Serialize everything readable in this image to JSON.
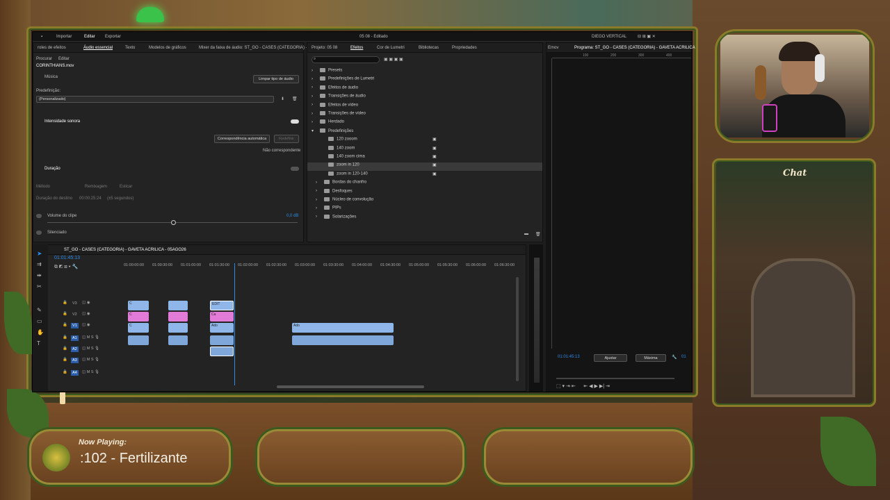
{
  "window": {
    "menu": [
      "Importar",
      "Editar",
      "Exportar"
    ],
    "title": "05 08 - Editado",
    "workspace": "DIEGO VERTICAL"
  },
  "essential": {
    "tabs": [
      "roles de efeitos",
      "Áudio essencial",
      "Texto",
      "Modelos de gráficos",
      "Mixer da faixa de áudio: ST_GO - CASES (CATEGORIA) -"
    ],
    "subtabs": [
      "Procurar",
      "Editar"
    ],
    "clip": "CORINTHIANS.mov",
    "type": "Música",
    "clear_btn": "Limpar tipo de áudio",
    "preset_label": "Predefinição:",
    "preset_value": "(Personalizado)",
    "loudness": "Intensidade sonora",
    "auto_match": "Correspondência automática",
    "reset": "Redefinir",
    "not_matched": "Não correspondente",
    "duration": "Duração",
    "method": "Método",
    "remix": "Remixagem",
    "stretch": "Esticar",
    "target_label": "Duração do destino",
    "target_time": "00:00:25:24",
    "target_secs": "(±5 segundos)",
    "clip_volume": "Volume do clipe",
    "volume_value": "0,0 dB",
    "mute": "Silenciado"
  },
  "effects": {
    "tabs": [
      "Projeto: 05 08",
      "Efeitos",
      "Cor de Lumetri",
      "Bibliotecas",
      "Propriedades"
    ],
    "items": [
      {
        "label": "Presets",
        "lvl": 0
      },
      {
        "label": "Predefinições de Lumetri",
        "lvl": 0
      },
      {
        "label": "Efeitos de áudio",
        "lvl": 0
      },
      {
        "label": "Transições de áudio",
        "lvl": 0
      },
      {
        "label": "Efeitos de vídeo",
        "lvl": 0
      },
      {
        "label": "Transições de vídeo",
        "lvl": 0
      },
      {
        "label": "Herdado",
        "lvl": 0
      },
      {
        "label": "Predefinições",
        "lvl": 0
      },
      {
        "label": "120 zooom",
        "lvl": 2
      },
      {
        "label": "140 zoom",
        "lvl": 2
      },
      {
        "label": "140 zoom cima",
        "lvl": 2
      },
      {
        "label": "zoom in 120",
        "lvl": 2,
        "sel": true
      },
      {
        "label": "zoom in 120-140",
        "lvl": 2
      },
      {
        "label": "Bordas do chanfro",
        "lvl": 1
      },
      {
        "label": "Desfoques",
        "lvl": 1
      },
      {
        "label": "Núcleo de convolução",
        "lvl": 1
      },
      {
        "label": "PIPs",
        "lvl": 1
      },
      {
        "label": "Solarizações",
        "lvl": 1
      }
    ]
  },
  "program": {
    "tab_left": "Emov",
    "tab": "Programa: ST_GO - CASES (CATEGORIA) - GAVETA ACRILICA",
    "ruler": [
      "100",
      "200",
      "300",
      "400",
      "500"
    ],
    "timecode": "01:01:45:13",
    "fit": "Ajustar",
    "quality": "Máxima",
    "right": "01"
  },
  "timeline": {
    "tab": "ST_GO - CASES (CATEGORIA) - GAVETA ACRILICA - 05AGO26",
    "timecode": "01:01:45:13",
    "ruler": [
      "01:00:00:00",
      "01:00:30:00",
      "01:01:00:00",
      "01:01:30:00",
      "01:02:00:00",
      "01:02:30:00",
      "01:03:00:00",
      "01:03:30:00",
      "01:04:00:00",
      "01:04:30:00",
      "01:05:00:00",
      "01:05:30:00",
      "01:06:00:00",
      "01:06:30:00"
    ],
    "tracks": [
      "V3",
      "V2",
      "V1",
      "A1",
      "A2",
      "A3",
      "A4"
    ],
    "clips": {
      "c": "C",
      "ed": "EDIT",
      "ca": "Ca",
      "ado": "Ado",
      "adj": "Ajus"
    }
  },
  "overlay": {
    "chat": "Chat",
    "now_playing": "Now Playing:",
    "song": ":102 - Fertilizante"
  },
  "colors": {
    "accent": "#2d8ceb",
    "frame": "#9a8a38"
  }
}
